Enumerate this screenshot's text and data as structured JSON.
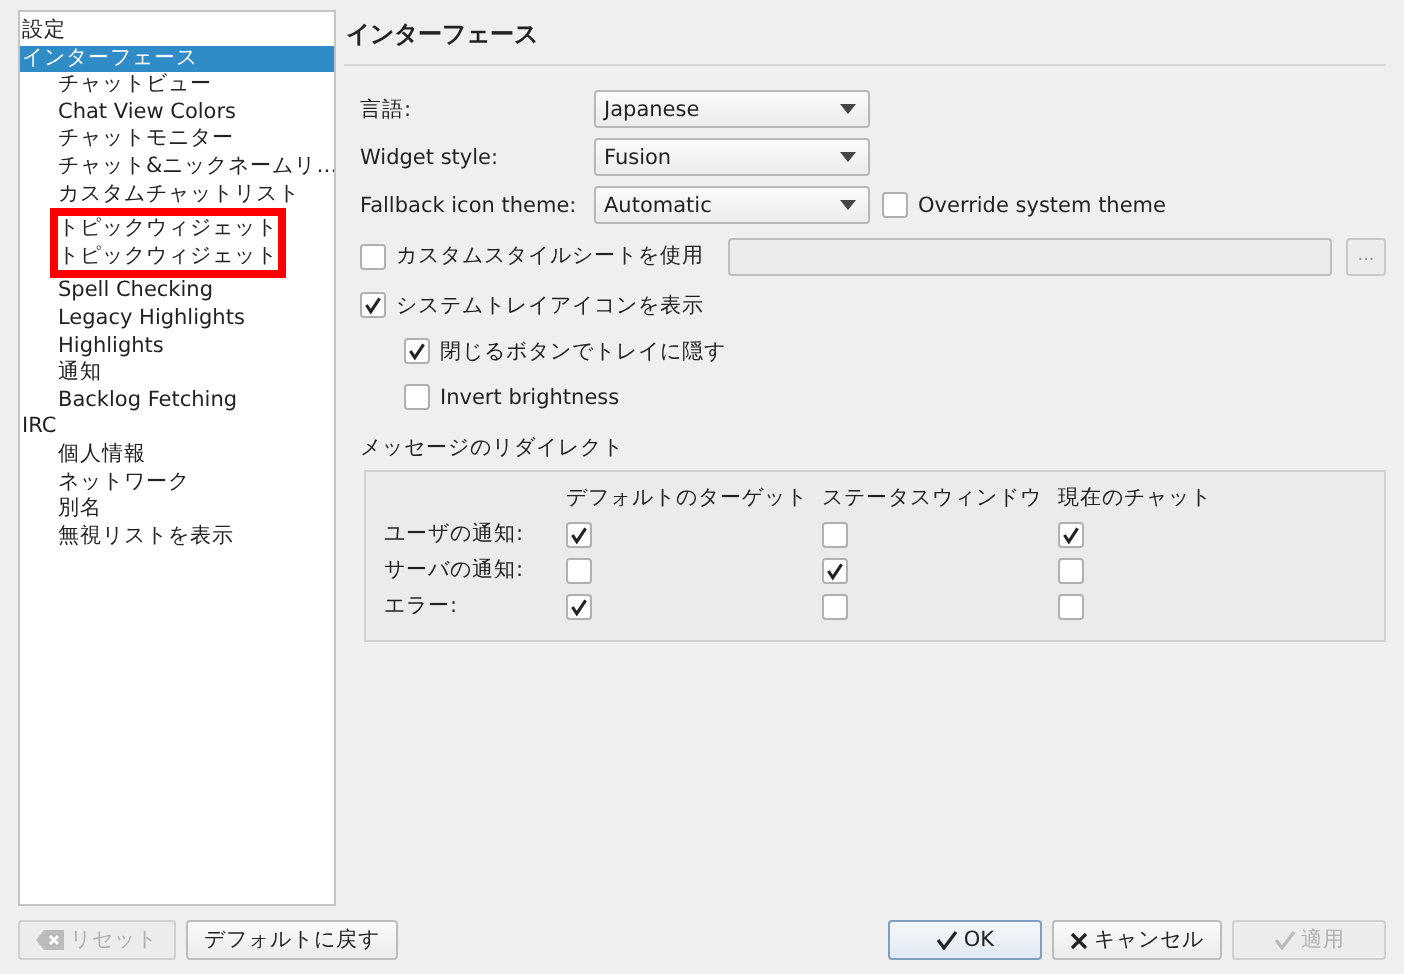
{
  "sidebar": {
    "items": [
      {
        "label": "設定",
        "selected": false
      },
      {
        "label": "インターフェース",
        "selected": true,
        "children": [
          {
            "label": "チャットビュー",
            "selected": false,
            "marked": false
          },
          {
            "label": "Chat View Colors",
            "selected": false,
            "marked": false
          },
          {
            "label": "チャットモニター",
            "selected": false,
            "marked": false
          },
          {
            "label": "チャット&ニックネームリ…",
            "selected": false,
            "marked": false
          },
          {
            "label": "カスタムチャットリスト",
            "selected": false,
            "marked": false
          },
          {
            "label": "トピックウィジェット",
            "selected": false,
            "marked": true
          },
          {
            "label": "トピックウィジェット",
            "selected": false,
            "marked": true
          },
          {
            "label": "Spell Checking",
            "selected": false,
            "marked": false
          },
          {
            "label": "Legacy Highlights",
            "selected": false,
            "marked": false
          },
          {
            "label": "Highlights",
            "selected": false,
            "marked": false
          },
          {
            "label": "通知",
            "selected": false,
            "marked": false
          },
          {
            "label": "Backlog Fetching",
            "selected": false,
            "marked": false
          }
        ]
      },
      {
        "label": "IRC",
        "selected": false,
        "children": [
          {
            "label": "個人情報",
            "selected": false,
            "marked": false
          },
          {
            "label": "ネットワーク",
            "selected": false,
            "marked": false
          },
          {
            "label": "別名",
            "selected": false,
            "marked": false
          },
          {
            "label": "無視リストを表示",
            "selected": false,
            "marked": false
          }
        ]
      }
    ]
  },
  "page": {
    "title": "インターフェース",
    "dropdowns": [
      {
        "label": "言語:",
        "value": "Japanese"
      },
      {
        "label": "Widget style:",
        "value": "Fusion"
      },
      {
        "label": "Fallback icon theme:",
        "value": "Automatic"
      }
    ],
    "override_theme": {
      "label": "Override system theme",
      "checked": false
    },
    "stylesheet": {
      "label": "カスタムスタイルシートを使用",
      "checked": false,
      "browse": "..."
    },
    "tray": {
      "label": "システムトレイアイコンを表示",
      "checked": true
    },
    "tray_options": [
      {
        "label": "閉じるボタンでトレイに隠す",
        "checked": true
      },
      {
        "label": "Invert brightness",
        "checked": false
      }
    ],
    "redirect": {
      "title": "メッセージのリダイレクト",
      "columns": [
        "デフォルトのターゲット",
        "ステータスウィンドウ",
        "現在のチャット"
      ],
      "rows": [
        {
          "label": "ユーザの通知:",
          "checks": [
            true,
            false,
            true
          ]
        },
        {
          "label": "サーバの通知:",
          "checks": [
            false,
            true,
            false
          ]
        },
        {
          "label": "エラー:",
          "checks": [
            true,
            false,
            false
          ]
        }
      ]
    }
  },
  "buttons_left": [
    {
      "label": "リセット",
      "disabled": true
    },
    {
      "label": "デフォルトに戻す",
      "disabled": false
    }
  ],
  "buttons_right": [
    {
      "label": "OK",
      "disabled": false,
      "default": true
    },
    {
      "label": "キャンセル",
      "disabled": false,
      "default": false
    },
    {
      "label": "適用",
      "disabled": true,
      "default": false
    }
  ]
}
